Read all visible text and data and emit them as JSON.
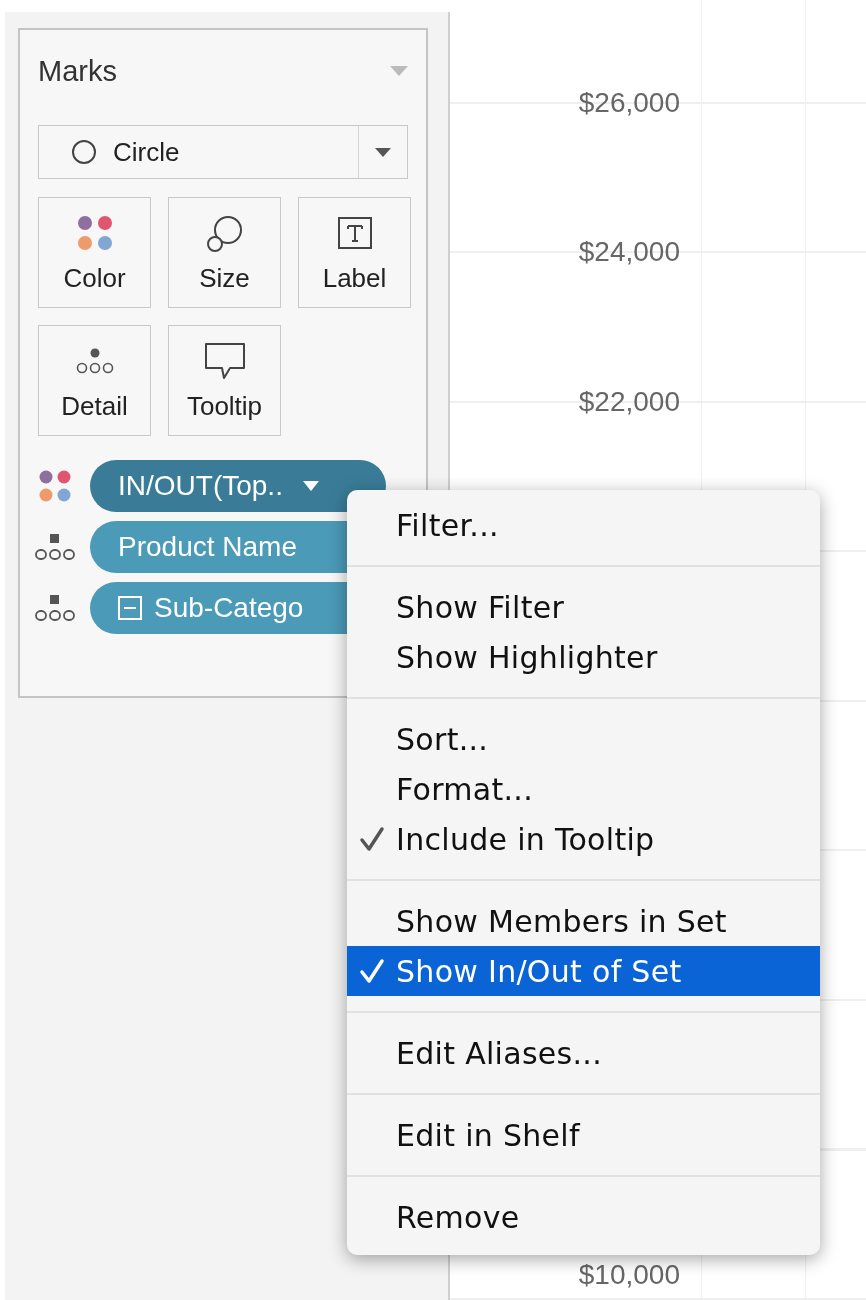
{
  "marks_card": {
    "title": "Marks",
    "mark_type": {
      "value": "Circle"
    },
    "shelf_buttons": [
      {
        "kind": "color",
        "label": "Color"
      },
      {
        "kind": "size",
        "label": "Size"
      },
      {
        "kind": "label",
        "label": "Label"
      },
      {
        "kind": "detail",
        "label": "Detail"
      },
      {
        "kind": "tooltip",
        "label": "Tooltip"
      }
    ],
    "fields": [
      {
        "kind": "color",
        "label": "IN/OUT(Top..",
        "selected": true,
        "collapse": false
      },
      {
        "kind": "detail",
        "label": "Product Name",
        "selected": false,
        "collapse": false
      },
      {
        "kind": "detail",
        "label": "Sub-Catego",
        "selected": false,
        "collapse": true
      }
    ]
  },
  "axis": {
    "top_labels": [
      "$26,000",
      "$24,000",
      "$22,000"
    ],
    "bottom_labels": [
      "$10,000"
    ]
  },
  "context_menu": {
    "groups": [
      [
        {
          "label": "Filter...",
          "checked": false,
          "selected": false
        }
      ],
      [
        {
          "label": "Show Filter",
          "checked": false,
          "selected": false
        },
        {
          "label": "Show Highlighter",
          "checked": false,
          "selected": false
        }
      ],
      [
        {
          "label": "Sort...",
          "checked": false,
          "selected": false
        },
        {
          "label": "Format...",
          "checked": false,
          "selected": false
        },
        {
          "label": "Include in Tooltip",
          "checked": true,
          "selected": false
        }
      ],
      [
        {
          "label": "Show Members in Set",
          "checked": false,
          "selected": false
        },
        {
          "label": "Show In/Out of Set",
          "checked": true,
          "selected": true
        }
      ],
      [
        {
          "label": "Edit Aliases...",
          "checked": false,
          "selected": false
        }
      ],
      [
        {
          "label": "Edit in Shelf",
          "checked": false,
          "selected": false
        }
      ],
      [
        {
          "label": "Remove",
          "checked": false,
          "selected": false
        }
      ]
    ]
  }
}
